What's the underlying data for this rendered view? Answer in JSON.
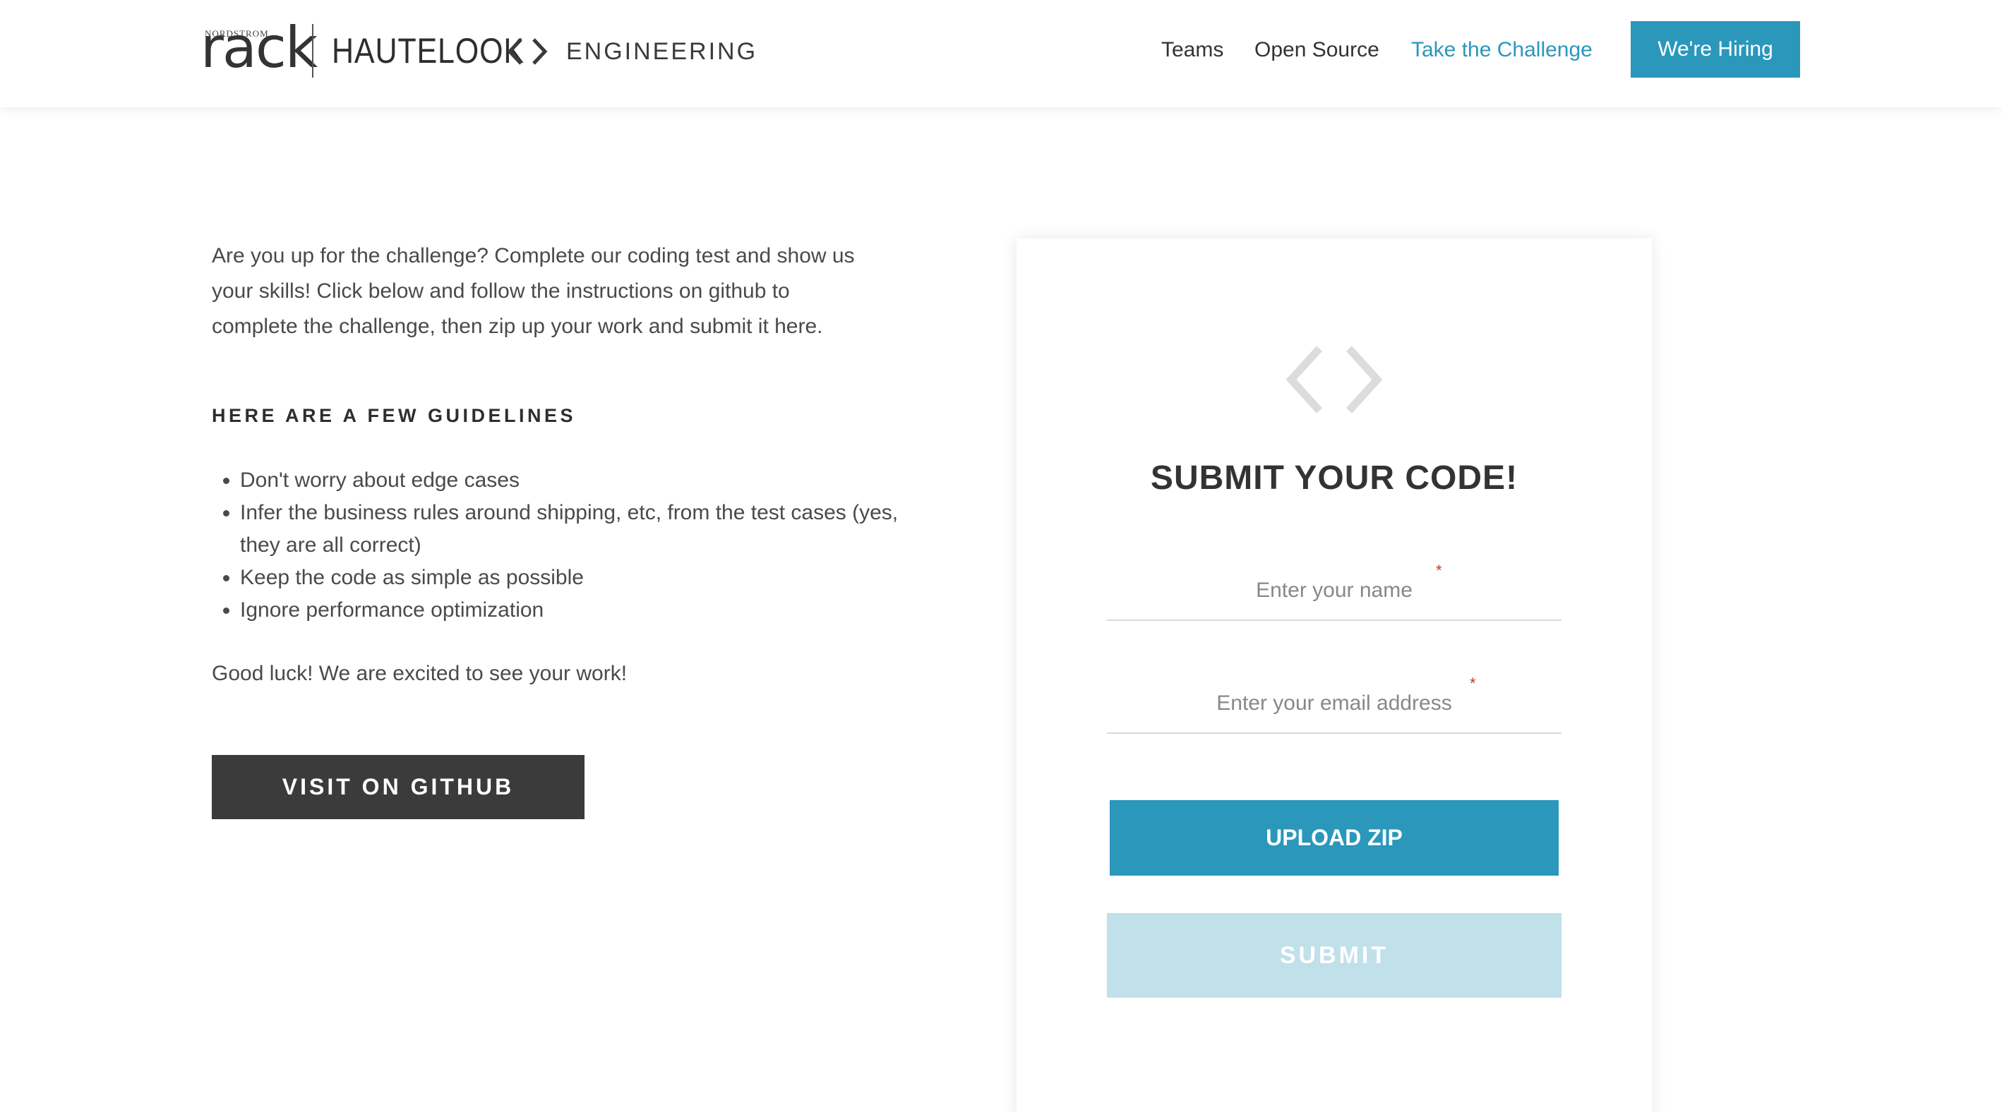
{
  "header": {
    "brand_small": "NORDSTROM",
    "brand_rack": "rack",
    "brand_hautelook": "HAUTELOOK",
    "brand_engineering": "ENGINEERING",
    "nav": {
      "teams": "Teams",
      "open_source": "Open Source",
      "challenge": "Take the Challenge",
      "hiring": "We're Hiring"
    }
  },
  "main": {
    "intro": "Are you up for the challenge? Complete our coding test and show us your skills! Click below and follow the instructions on github to complete the challenge, then zip up your work and submit it here.",
    "guidelines_title": "HERE ARE A FEW GUIDELINES",
    "guidelines": [
      "Don't worry about edge cases",
      "Infer the business rules around shipping, etc, from the test cases (yes, they are all correct)",
      "Keep the code as simple as possible",
      "Ignore performance optimization"
    ],
    "closing": "Good luck! We are excited to see your work!",
    "github_button": "VISIT ON GITHUB"
  },
  "form": {
    "title": "SUBMIT YOUR CODE!",
    "name_placeholder": "Enter your name",
    "email_placeholder": "Enter your email address",
    "required_mark": "*",
    "upload_button": "UPLOAD ZIP",
    "submit_button": "SUBMIT"
  },
  "colors": {
    "accent": "#2a97bb",
    "dark_button": "#3b3b3b",
    "submit_disabled": "#c0e0ea",
    "required": "#c0392b"
  },
  "icons": {
    "brand_code": "code-brackets-icon",
    "card_code": "code-brackets-icon"
  }
}
